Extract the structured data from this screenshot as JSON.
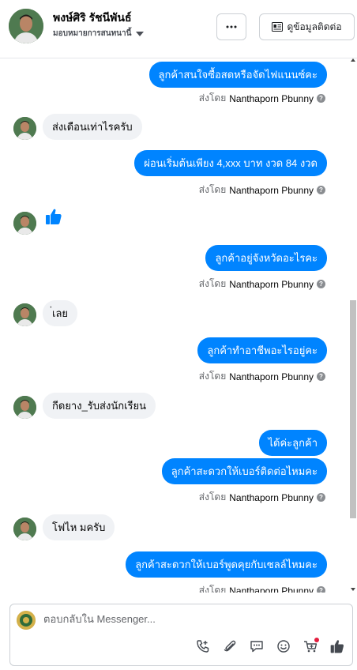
{
  "header": {
    "name": "พงษ์ศิริ รัชนีพันธ์",
    "status": "มอบหมายการสนทนานี้",
    "more_label": "···",
    "contact_label": "ดูข้อมูลติดต่อ"
  },
  "messages": [
    {
      "type": "out",
      "text": "ลูกค้าสนใจซื้อสดหรือจัดไฟแนนซ์คะ",
      "sent_by_prefix": "ส่งโดย",
      "sender": "Nanthaporn Pbunny"
    },
    {
      "type": "in",
      "text": "ส่งเดือนเท่าไรครับ"
    },
    {
      "type": "out",
      "text": "ผ่อนเริ่มต้นเพียง 4,xxx บาท งวด 84 งวด",
      "sent_by_prefix": "ส่งโดย",
      "sender": "Nanthaporn Pbunny"
    },
    {
      "type": "in-like"
    },
    {
      "type": "out",
      "text": "ลูกค้าอยู่จังหวัดอะไรคะ",
      "sent_by_prefix": "ส่งโดย",
      "sender": "Nanthaporn Pbunny"
    },
    {
      "type": "in",
      "text": "่เลย"
    },
    {
      "type": "out",
      "text": "ลูกค้าทำอาชีพอะไรอยู่คะ",
      "sent_by_prefix": "ส่งโดย",
      "sender": "Nanthaporn Pbunny"
    },
    {
      "type": "in",
      "text": "กีดยาง_รับส่งนักเรียน"
    },
    {
      "type": "out",
      "text": "ได้ค่ะลูกค้า"
    },
    {
      "type": "out",
      "text": "ลูกค้าสะดวกให้เบอร์ติดต่อไหมคะ",
      "sent_by_prefix": "ส่งโดย",
      "sender": "Nanthaporn Pbunny"
    },
    {
      "type": "in",
      "text": "โฟไห มครับ"
    },
    {
      "type": "out",
      "text": "ลูกค้าสะดวกให้เบอร์พูดคุยกับเซลล์ไหมคะ",
      "sent_by_prefix": "ส่งโดย",
      "sender": "Nanthaporn Pbunny"
    }
  ],
  "composer": {
    "placeholder": "ตอบกลับใน Messenger..."
  },
  "tools": [
    "phone-icon",
    "attachment-icon",
    "saved-reply-icon",
    "emoji-icon",
    "cart-icon",
    "like-icon"
  ],
  "colors": {
    "accent": "#0084ff",
    "incoming": "#f0f2f5",
    "notification": "#e41e3f"
  }
}
